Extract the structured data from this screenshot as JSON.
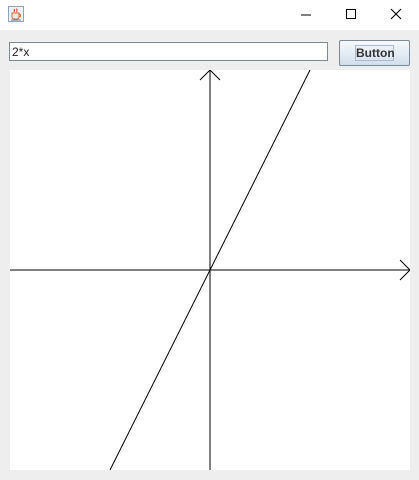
{
  "window": {
    "app_icon": "java-cup-icon",
    "controls": [
      "minimize-icon",
      "maximize-icon",
      "close-icon"
    ]
  },
  "toolbar": {
    "formula_value": "2*x",
    "button_label": "Button"
  },
  "plot": {
    "function": "2*x",
    "axis_color": "#000000",
    "line_color": "#000000",
    "background": "#ffffff"
  }
}
